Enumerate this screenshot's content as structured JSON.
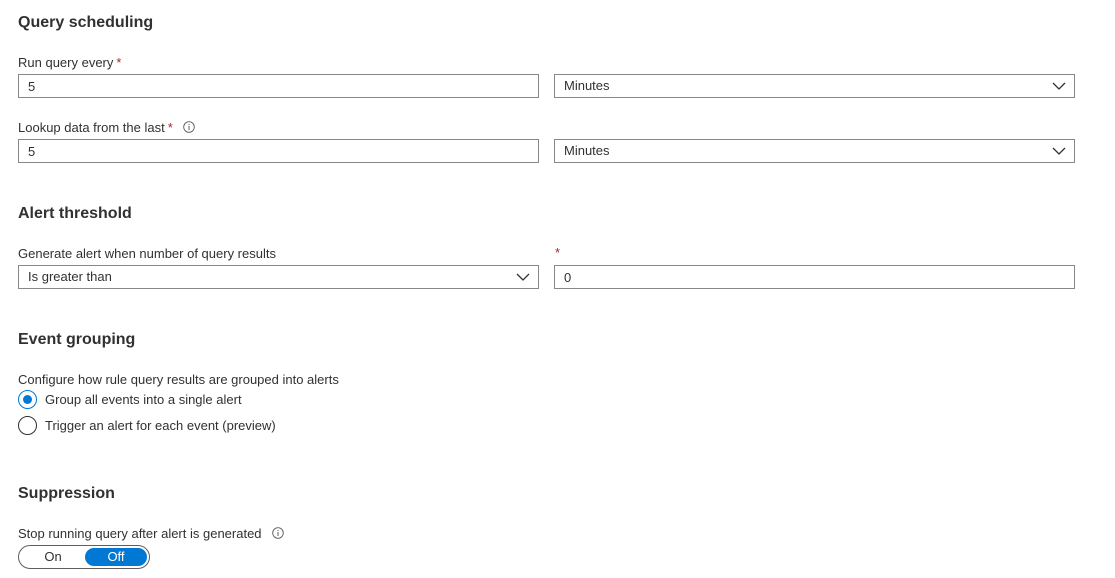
{
  "scheduling": {
    "title": "Query scheduling",
    "run_every": {
      "label": "Run query every",
      "required": "*",
      "value": "5",
      "unit": "Minutes"
    },
    "lookup": {
      "label": "Lookup data from the last",
      "required": "*",
      "value": "5",
      "unit": "Minutes"
    }
  },
  "threshold": {
    "title": "Alert threshold",
    "label": "Generate alert when number of query results",
    "required": "*",
    "operator": "Is greater than",
    "value": "0"
  },
  "grouping": {
    "title": "Event grouping",
    "label": "Configure how rule query results are grouped into alerts",
    "options": [
      {
        "label": "Group all events into a single alert",
        "selected": true
      },
      {
        "label": "Trigger an alert for each event (preview)",
        "selected": false
      }
    ]
  },
  "suppression": {
    "title": "Suppression",
    "label": "Stop running query after alert is generated",
    "toggle": {
      "on_label": "On",
      "off_label": "Off",
      "state": "Off"
    }
  },
  "icons": {
    "info": "info-icon",
    "dropdown": "chevron-down-icon"
  },
  "colors": {
    "accent": "#0078d4",
    "required": "#a4262c",
    "border": "#8a8886"
  }
}
